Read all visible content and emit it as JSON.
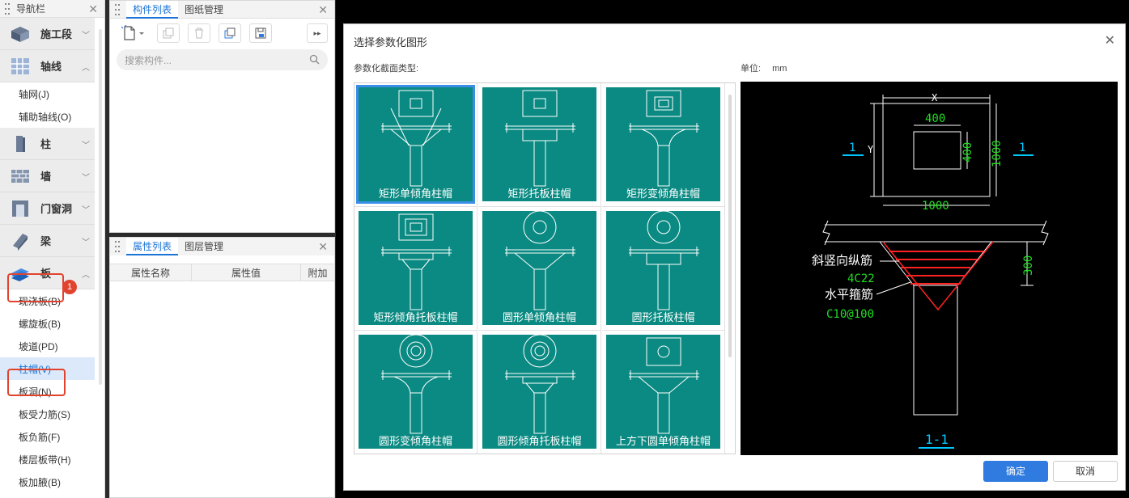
{
  "nav": {
    "title": "导航栏",
    "categories": [
      {
        "label": "施工段"
      },
      {
        "label": "轴线"
      },
      {
        "label": "柱"
      },
      {
        "label": "墙"
      },
      {
        "label": "门窗洞"
      },
      {
        "label": "梁"
      },
      {
        "label": "板"
      }
    ],
    "axis_items": [
      "轴网(J)",
      "辅助轴线(O)"
    ],
    "slab_items": [
      "现浇板(B)",
      "螺旋板(B)",
      "坡道(PD)",
      "柱帽(V)",
      "板洞(N)",
      "板受力筋(S)",
      "板负筋(F)",
      "楼层板带(H)",
      "板加腋(B)"
    ],
    "badge": "1"
  },
  "component_panel": {
    "tabs": [
      "构件列表",
      "图纸管理"
    ],
    "search_placeholder": "搜索构件..."
  },
  "property_panel": {
    "tabs": [
      "属性列表",
      "图层管理"
    ],
    "columns": [
      "属性名称",
      "属性值",
      "附加"
    ]
  },
  "dialog": {
    "title": "选择参数化图形",
    "section_label": "参数化截面类型:",
    "unit_label": "单位:",
    "unit_value": "mm",
    "shapes": [
      "矩形单倾角柱帽",
      "矩形托板柱帽",
      "矩形变倾角柱帽",
      "矩形倾角托板柱帽",
      "圆形单倾角柱帽",
      "圆形托板柱帽",
      "圆形变倾角柱帽",
      "圆形倾角托板柱帽",
      "上方下圆单倾角柱帽"
    ],
    "ok": "确定",
    "cancel": "取消"
  },
  "preview": {
    "x_label": "X",
    "y_label": "Y",
    "inner_w": "400",
    "inner_h": "400",
    "outer_h": "1000",
    "outer_w": "1000",
    "sec_mark": "1",
    "height": "300",
    "label_vertical": "斜竖向纵筋",
    "vertical_spec": "4C22",
    "label_hoop": "水平箍筋",
    "hoop_spec": "C10@100",
    "section_title": "1-1"
  },
  "colors": {
    "tile": "#0a8a82",
    "accent": "#2f7be0",
    "highlight": "#e1442e",
    "cad_green": "#22dd22",
    "cad_cyan": "#00c8ff",
    "cad_red": "#ff2222"
  }
}
